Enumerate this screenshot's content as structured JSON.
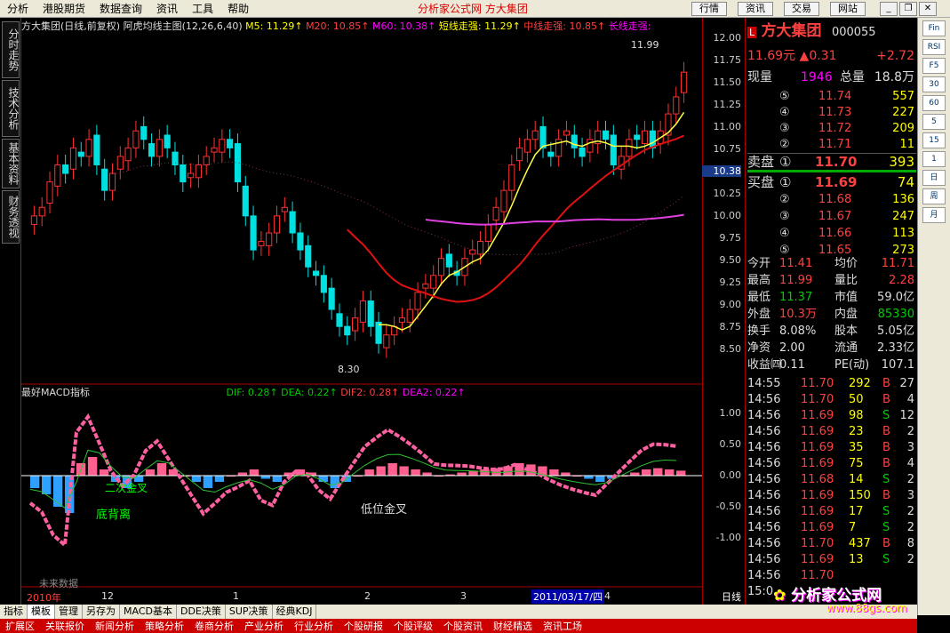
{
  "menu": {
    "items": [
      "分析",
      "港股期货",
      "数据查询",
      "资讯",
      "工具",
      "帮助"
    ],
    "center_title": "分析家公式网  方大集团",
    "right_buttons": [
      "行情",
      "资讯",
      "交易",
      "网站"
    ]
  },
  "left_tabs": [
    "分时走势",
    "技术分析",
    "基本资料",
    "财务透视"
  ],
  "main_header": {
    "stock": "方大集团(日线,前复权)",
    "indicator": "阿虎均线主图(12,26,6,40)",
    "m5": "M5: 11.29↑",
    "m20": "M20: 10.85↑",
    "m60": "M60: 10.38↑",
    "short": "短线走强: 11.29↑",
    "mid": "中线走强: 10.85↑",
    "long": "长线走强:"
  },
  "macd_header": {
    "name": "最好MACD指标",
    "dif": "DIF: 0.28↑",
    "dea": "DEA: 0.22↑",
    "dif2": "DIF2: 0.28↑",
    "dea2": "DEA2: 0.22↑"
  },
  "annotations": {
    "high": "11.99",
    "low": "8.30",
    "second_cross": "二次金叉",
    "bottom_divergence": "底背离",
    "low_golden_cross": "低位金叉",
    "future_data": "未来数据",
    "price_marker": "10.38"
  },
  "price_axis": [
    "12.00",
    "11.75",
    "11.50",
    "11.25",
    "11.00",
    "10.75",
    "10.50",
    "10.25",
    "10.00",
    "9.75",
    "9.50",
    "9.25",
    "9.00",
    "8.75",
    "8.50"
  ],
  "macd_axis": [
    "1.00",
    "0.50",
    "0.00",
    "-0.50",
    "-1.00"
  ],
  "time_axis": [
    "2010年",
    "12",
    "1",
    "2",
    "3",
    "2011/03/17/四",
    "4"
  ],
  "period_label": "日线",
  "quote": {
    "name": "方大集团",
    "code": "000055",
    "price": "11.69元",
    "change": "▲0.31",
    "pct": "+2.72",
    "volume_label": "现量",
    "volume": "1946",
    "total_label": "总量",
    "total": "18.8万",
    "asks": [
      {
        "lv": "⑤",
        "p": "11.74",
        "v": "557"
      },
      {
        "lv": "④",
        "p": "11.73",
        "v": "227"
      },
      {
        "lv": "③",
        "p": "11.72",
        "v": "209"
      },
      {
        "lv": "②",
        "p": "11.71",
        "v": "11"
      }
    ],
    "ask1": {
      "label": "卖盘",
      "lv": "①",
      "p": "11.70",
      "v": "393"
    },
    "bid1": {
      "label": "买盘",
      "lv": "①",
      "p": "11.69",
      "v": "74"
    },
    "bids": [
      {
        "lv": "②",
        "p": "11.68",
        "v": "136"
      },
      {
        "lv": "③",
        "p": "11.67",
        "v": "247"
      },
      {
        "lv": "④",
        "p": "11.66",
        "v": "113"
      },
      {
        "lv": "⑤",
        "p": "11.65",
        "v": "273"
      }
    ],
    "stats": [
      {
        "k1": "今开",
        "v1": "11.41",
        "k2": "均价",
        "v2": "11.71"
      },
      {
        "k1": "最高",
        "v1": "11.99",
        "k2": "量比",
        "v2": "2.28"
      },
      {
        "k1": "最低",
        "v1": "11.37",
        "k2": "市值",
        "v2": "59.0亿"
      },
      {
        "k1": "外盘",
        "v1": "10.3万",
        "k2": "内盘",
        "v2": "85330"
      },
      {
        "k1": "换手",
        "v1": "8.08%",
        "k2": "股本",
        "v2": "5.05亿"
      },
      {
        "k1": "净资",
        "v1": "2.00",
        "k2": "流通",
        "v2": "2.33亿"
      },
      {
        "k1": "收益㈣",
        "v1": "0.11",
        "k2": "PE(动)",
        "v2": "107.1"
      }
    ],
    "ticks": [
      {
        "t": "14:55",
        "p": "11.70",
        "v": "292",
        "s": "B",
        "n": "27"
      },
      {
        "t": "14:56",
        "p": "11.70",
        "v": "50",
        "s": "B",
        "n": "4"
      },
      {
        "t": "14:56",
        "p": "11.69",
        "v": "98",
        "s": "S",
        "n": "12"
      },
      {
        "t": "14:56",
        "p": "11.69",
        "v": "23",
        "s": "B",
        "n": "2"
      },
      {
        "t": "14:56",
        "p": "11.69",
        "v": "35",
        "s": "B",
        "n": "3"
      },
      {
        "t": "14:56",
        "p": "11.69",
        "v": "75",
        "s": "B",
        "n": "4"
      },
      {
        "t": "14:56",
        "p": "11.68",
        "v": "14",
        "s": "S",
        "n": "2"
      },
      {
        "t": "14:56",
        "p": "11.69",
        "v": "150",
        "s": "B",
        "n": "3"
      },
      {
        "t": "14:56",
        "p": "11.69",
        "v": "17",
        "s": "S",
        "n": "2"
      },
      {
        "t": "14:56",
        "p": "11.69",
        "v": "7",
        "s": "S",
        "n": "2"
      },
      {
        "t": "14:56",
        "p": "11.70",
        "v": "437",
        "B": "",
        "s": "B",
        "n": "8"
      },
      {
        "t": "14:56",
        "p": "11.69",
        "v": "13",
        "s": "S",
        "n": "2"
      },
      {
        "t": "14:56",
        "p": "11.70",
        "v": "",
        "s": "",
        "n": ""
      },
      {
        "t": "15:0",
        "p": "",
        "v": "",
        "s": "",
        "n": ""
      }
    ]
  },
  "bottom_tabs": [
    "指标",
    "模板",
    "管理",
    "另存为",
    "MACD基本",
    "DDE决策",
    "SUP决策",
    "经典KDJ"
  ],
  "status_items": [
    "扩展区",
    "关联报价",
    "新闻分析",
    "策略分析",
    "卷商分析",
    "产业分析",
    "行业分析",
    "个股研报",
    "个股评级",
    "个股资讯",
    "财经精选",
    "资讯工场"
  ],
  "logo": {
    "text": "分析家公式网",
    "url": "www.88gs.com"
  },
  "toolstrip": [
    "Fin",
    "RSI",
    "F5",
    "30",
    "60",
    "5",
    "15",
    "1",
    "日",
    "周",
    "月"
  ],
  "chart_data": {
    "type": "candlestick",
    "title": "方大集团(日线,前复权)",
    "ylim": [
      8.3,
      12.1
    ],
    "annotated_high": 11.99,
    "annotated_low": 8.3,
    "ma_current": {
      "M5": 11.29,
      "M20": 10.85,
      "M60": 10.38
    },
    "closes": [
      10.0,
      10.1,
      10.4,
      10.6,
      10.5,
      10.8,
      10.7,
      10.9,
      10.6,
      10.3,
      10.5,
      10.7,
      10.8,
      11.0,
      10.9,
      10.7,
      10.9,
      10.8,
      10.6,
      10.4,
      10.5,
      10.6,
      10.7,
      10.8,
      10.9,
      10.8,
      10.4,
      10.0,
      9.6,
      9.7,
      9.8,
      10.0,
      10.1,
      9.8,
      9.6,
      9.4,
      9.3,
      9.1,
      8.9,
      8.7,
      8.6,
      8.8,
      9.0,
      8.7,
      8.5,
      8.6,
      8.7,
      8.8,
      8.9,
      9.1,
      9.2,
      9.3,
      9.5,
      9.4,
      9.3,
      9.5,
      9.6,
      9.7,
      9.9,
      10.1,
      10.3,
      10.6,
      10.8,
      10.9,
      11.0,
      10.8,
      10.7,
      10.9,
      11.0,
      10.8,
      10.7,
      10.9,
      11.0,
      10.9,
      10.6,
      10.7,
      10.9,
      10.9,
      11.0,
      10.8,
      11.0,
      11.2,
      11.4,
      11.69
    ],
    "macd": {
      "DIF": 0.28,
      "DEA": 0.22,
      "DIF2": 0.28,
      "DEA2": 0.22,
      "ylim": [
        -1.2,
        1.2
      ],
      "hist": [
        -0.2,
        -0.3,
        -0.5,
        -0.6,
        0.2,
        0.3,
        0.1,
        -0.1,
        -0.2,
        -0.1,
        0.1,
        0.2,
        0.1,
        0.0,
        -0.1,
        -0.2,
        -0.1,
        0.0,
        0.05,
        0.1,
        -0.05,
        -0.1,
        0.05,
        0.1,
        0.05,
        -0.1,
        -0.2,
        -0.1,
        0.0,
        0.1,
        0.15,
        0.2,
        0.15,
        0.1,
        0.05,
        0.0,
        0.02,
        0.05,
        0.08,
        0.1,
        0.12,
        0.15,
        0.2,
        0.18,
        0.15,
        0.1,
        0.05,
        0.0,
        -0.05,
        -0.1,
        -0.05,
        0.0,
        0.05,
        0.1,
        0.12,
        0.1,
        0.08
      ]
    }
  }
}
